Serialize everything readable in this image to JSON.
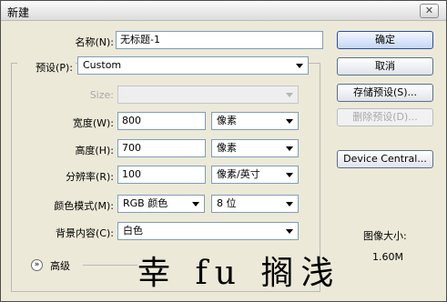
{
  "window": {
    "title": "新建",
    "close_glyph": "✕"
  },
  "form": {
    "name": {
      "label": "名称(N):",
      "value": "无标题-1"
    },
    "preset": {
      "label": "预设(P):",
      "value": "Custom"
    },
    "size": {
      "label": "Size:",
      "value": ""
    },
    "width": {
      "label": "宽度(W):",
      "value": "800",
      "unit": "像素"
    },
    "height": {
      "label": "高度(H):",
      "value": "700",
      "unit": "像素"
    },
    "resolution": {
      "label": "分辨率(R):",
      "value": "100",
      "unit": "像素/英寸"
    },
    "color_mode": {
      "label": "颜色模式(M):",
      "value": "RGB 颜色",
      "depth": "8 位"
    },
    "background": {
      "label": "背景内容(C):",
      "value": "白色"
    },
    "advanced": {
      "label": "高级"
    }
  },
  "buttons": {
    "ok": "确定",
    "cancel": "取消",
    "save_preset": "存储预设(S)...",
    "delete_preset": "删除预设(D)...",
    "device_central": "Device Central..."
  },
  "image_size": {
    "label": "图像大小:",
    "value": "1.60M"
  },
  "watermark": "幸 fu 搁浅",
  "icons": {
    "close": "close-icon",
    "advanced": "chevron-double-down-icon",
    "dropdown": "chevron-down-icon"
  }
}
